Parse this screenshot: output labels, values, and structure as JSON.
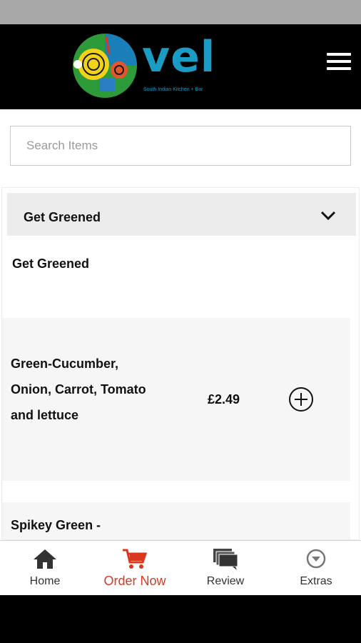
{
  "header": {
    "logo_word": "vel",
    "logo_tagline": "South Indian Kitchen + Bar",
    "menu_icon": "hamburger-menu-icon"
  },
  "search": {
    "placeholder": "Search Items",
    "value": ""
  },
  "category": {
    "title": "Get Greened",
    "subtitle": "Get Greened",
    "chevron_icon": "chevron-down-icon",
    "items": [
      {
        "name": "Green-Cucumber, Onion, Carrot, Tomato and lettuce",
        "price": "£2.49"
      },
      {
        "name": "Spikey Green -",
        "price": ""
      }
    ]
  },
  "bottom_nav": {
    "items": [
      {
        "label": "Home",
        "icon": "home-icon"
      },
      {
        "label": "Order Now",
        "icon": "cart-icon",
        "active": true
      },
      {
        "label": "Review",
        "icon": "chat-icon"
      },
      {
        "label": "Extras",
        "icon": "chevron-circle-icon"
      }
    ]
  },
  "colors": {
    "header_bg": "#000000",
    "brand": "#1a9cc4",
    "accent": "#d9381e",
    "category_bg": "#ececec",
    "row_bg": "#f6f6f6"
  }
}
